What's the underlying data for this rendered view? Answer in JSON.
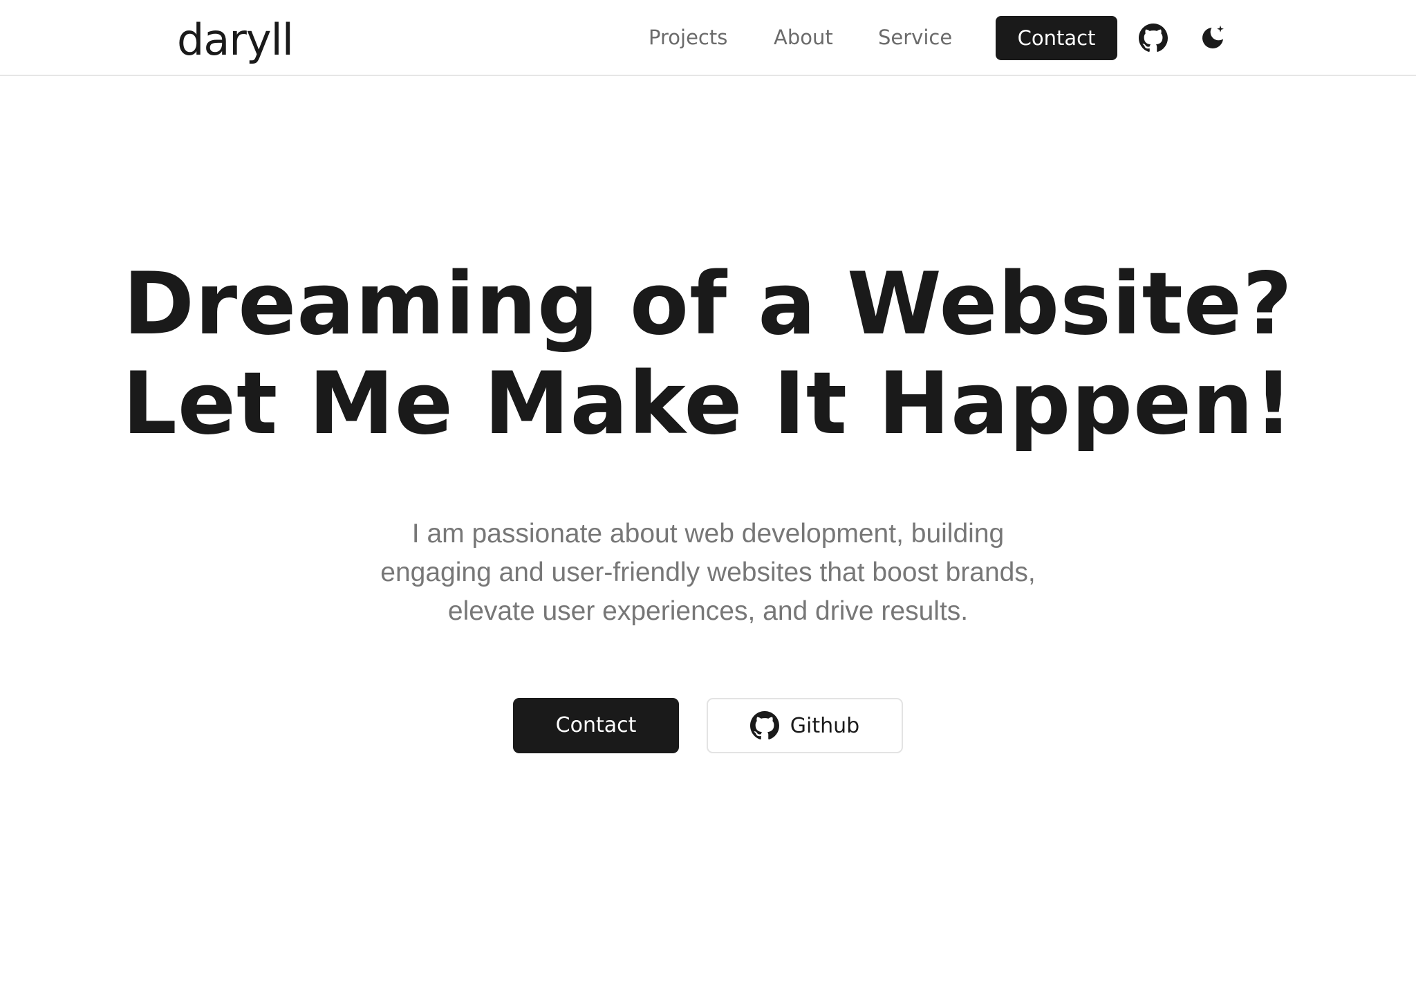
{
  "header": {
    "logo": "daryll",
    "nav": {
      "projects": "Projects",
      "about": "About",
      "service": "Service",
      "contact": "Contact"
    },
    "icons": {
      "github": "github-icon",
      "theme": "moon-sparkle-icon"
    }
  },
  "hero": {
    "title_line1": "Dreaming of a Website?",
    "title_line2": "Let Me Make It Happen!",
    "description": "I am passionate about web development, building engaging and user-friendly websites that boost brands, elevate user experiences, and drive results.",
    "primary_button": "Contact",
    "secondary_button": "Github"
  },
  "colors": {
    "text": "#1a1a1a",
    "muted": "#777777",
    "nav_text": "#6b6b6b",
    "button_dark": "#1a1a1a",
    "border": "#e3e3e3",
    "background": "#ffffff"
  }
}
